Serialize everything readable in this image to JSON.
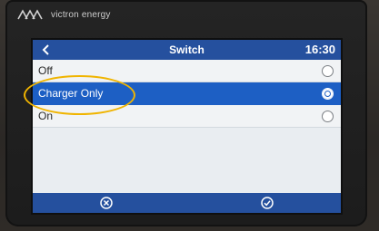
{
  "device": {
    "brand": "victron energy"
  },
  "header": {
    "title": "Switch",
    "time": "16:30"
  },
  "options": [
    {
      "label": "Off",
      "selected": false
    },
    {
      "label": "Charger Only",
      "selected": true
    },
    {
      "label": "On",
      "selected": false
    }
  ],
  "footer": {
    "cancel_icon": "cancel-circle-icon",
    "confirm_icon": "check-circle-icon"
  },
  "colors": {
    "accent": "#25509e",
    "selected": "#1d5fc4",
    "annotation": "#f0b400"
  }
}
